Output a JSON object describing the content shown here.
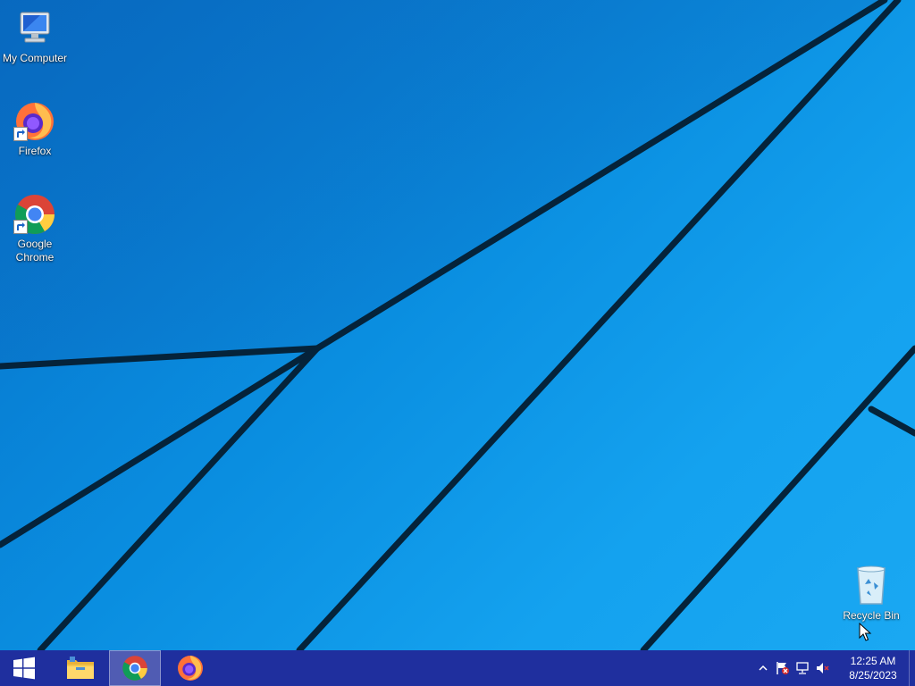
{
  "desktop": {
    "icons": [
      {
        "label": "My Computer",
        "icon": "my-computer-icon"
      },
      {
        "label": "Firefox",
        "icon": "firefox-icon"
      },
      {
        "label": "Google Chrome",
        "icon": "chrome-icon"
      },
      {
        "label": "Recycle Bin",
        "icon": "recycle-bin-icon"
      }
    ]
  },
  "taskbar": {
    "start": {
      "icon": "windows-logo-icon"
    },
    "pinned": [
      {
        "name": "File Explorer",
        "icon": "file-explorer-icon",
        "active": false
      },
      {
        "name": "Google Chrome",
        "icon": "chrome-icon",
        "active": true
      },
      {
        "name": "Firefox",
        "icon": "firefox-icon",
        "active": false
      }
    ],
    "tray": {
      "icons": [
        "show-hidden-icons-chevron",
        "action-center-flag-icon",
        "network-icon",
        "volume-muted-icon"
      ],
      "time": "12:25 AM",
      "date": "8/25/2023"
    }
  },
  "colors": {
    "taskbar": "#1f2f9e",
    "desktop_blue": "#0a8ee0"
  }
}
